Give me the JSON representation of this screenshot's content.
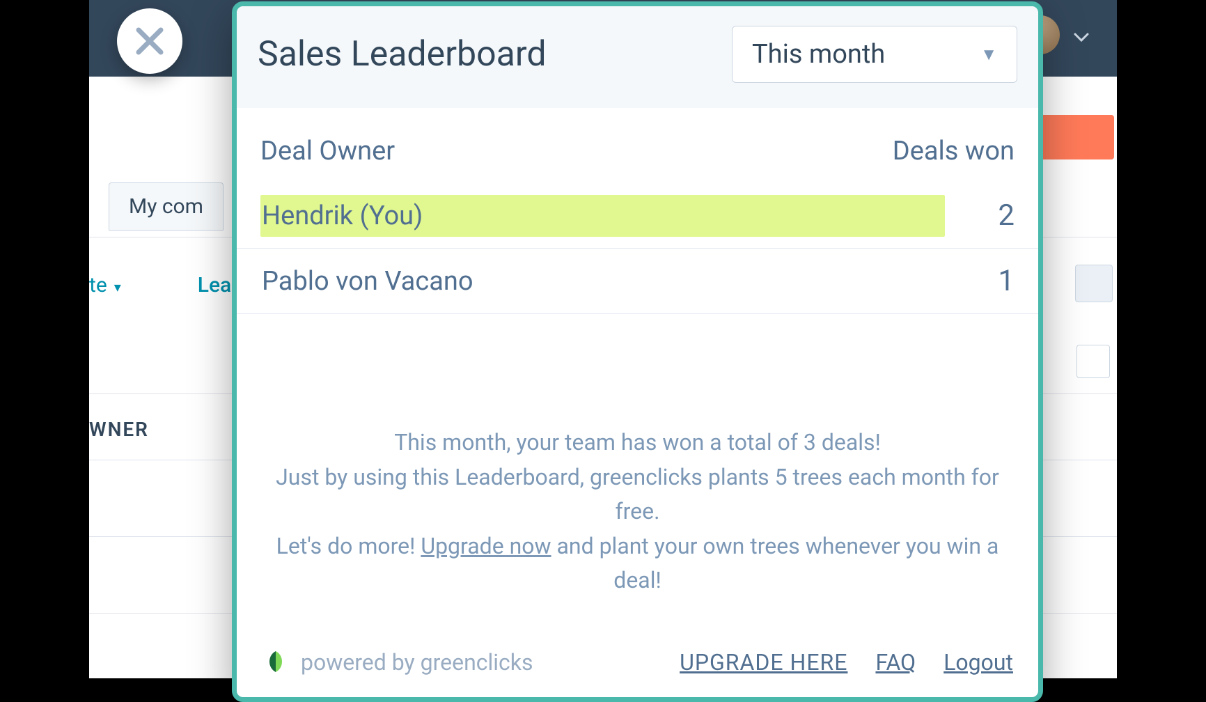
{
  "background": {
    "tab_label": "My com",
    "filter_te": "te",
    "filter_lea": "Lea",
    "owner_header": "WNER",
    "dash1": "--",
    "dash2": "--"
  },
  "modal": {
    "title": "Sales Leaderboard",
    "period_selected": "This month",
    "columns": {
      "owner": "Deal Owner",
      "won": "Deals won"
    },
    "rows": [
      {
        "name": "Hendrik (You)",
        "count": "2",
        "highlight": true
      },
      {
        "name": "Pablo von Vacano",
        "count": "1",
        "highlight": false
      }
    ],
    "summary": {
      "line1": "This month, your team has won a total of 3 deals!",
      "line2": "Just by using this Leaderboard, greenclicks plants 5 trees each month for free.",
      "line3_a": "Let's do more! ",
      "upgrade_now": "Upgrade now",
      "line3_b": " and plant your own trees whenever you win a deal!"
    },
    "footer": {
      "powered": "powered by greenclicks",
      "upgrade_here": "UPGRADE HERE",
      "faq": "FAQ",
      "logout": "Logout"
    }
  }
}
